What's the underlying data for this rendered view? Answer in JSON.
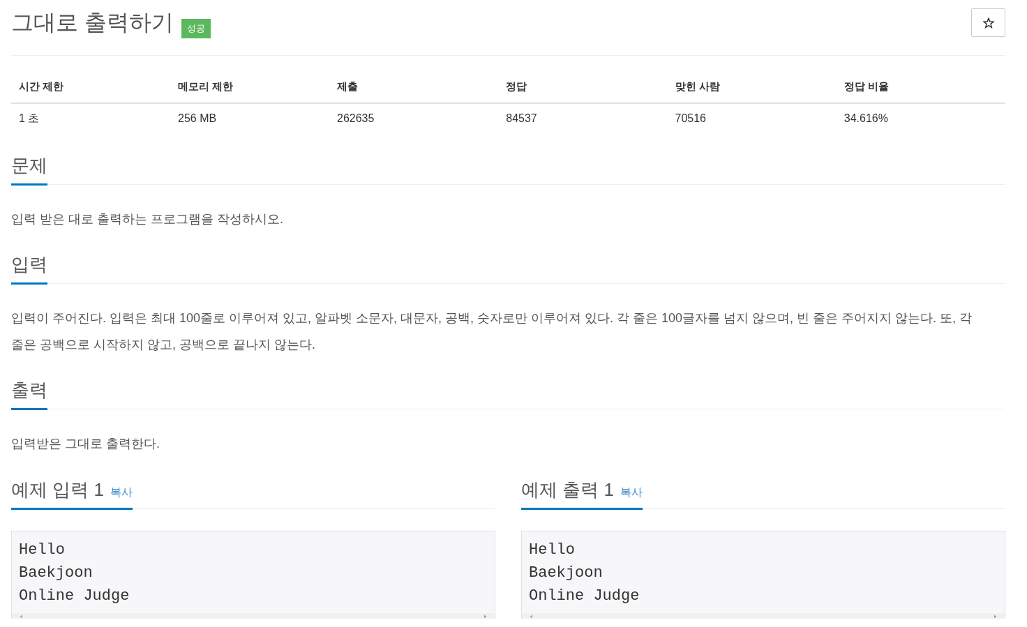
{
  "problem": {
    "title": "그대로 출력하기",
    "badge": "성공"
  },
  "info_table": {
    "columns": [
      "시간 제한",
      "메모리 제한",
      "제출",
      "정답",
      "맞힌 사람",
      "정답 비율"
    ],
    "rows": [
      [
        "1 초",
        "256 MB",
        "262635",
        "84537",
        "70516",
        "34.616%"
      ]
    ]
  },
  "sections": [
    {
      "heading": "문제",
      "text": "입력 받은 대로 출력하는 프로그램을 작성하시오."
    },
    {
      "heading": "입력",
      "text": "입력이 주어진다. 입력은 최대 100줄로 이루어져 있고, 알파벳 소문자, 대문자, 공백, 숫자로만 이루어져 있다. 각 줄은 100글자를 넘지 않으며, 빈 줄은 주어지지 않는다. 또, 각 줄은 공백으로 시작하지 않고, 공백으로 끝나지 않는다."
    },
    {
      "heading": "출력",
      "text": "입력받은 그대로 출력한다."
    }
  ],
  "samples": [
    {
      "heading": "예제 입력 1",
      "copy_link": "복사",
      "lines": [
        "Hello",
        "Baekjoon",
        "Online Judge"
      ]
    },
    {
      "heading": "예제 출력 1",
      "copy_link": "복사",
      "lines": [
        "Hello",
        "Baekjoon",
        "Online Judge"
      ]
    }
  ]
}
